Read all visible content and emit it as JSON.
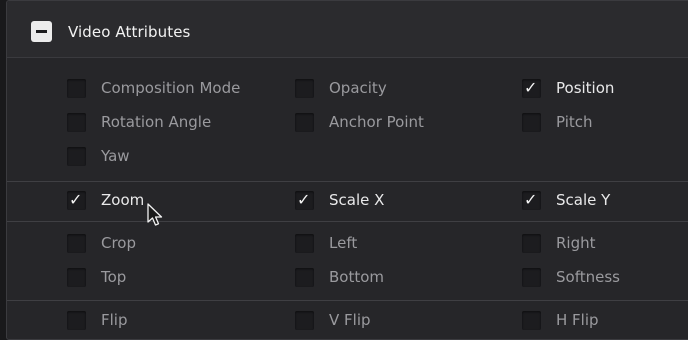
{
  "panel": {
    "title": "Video Attributes",
    "collapse_icon": "minus-icon",
    "check_glyph": "✓"
  },
  "colors": {
    "panel_bg": "#262629",
    "checkbox_bg": "#1c1c1f",
    "label_active": "#e9e9ea",
    "label_inactive": "#9a9a9e"
  },
  "attributes": {
    "composition_mode": {
      "label": "Composition Mode",
      "checked": false
    },
    "opacity": {
      "label": "Opacity",
      "checked": false
    },
    "position": {
      "label": "Position",
      "checked": true
    },
    "rotation_angle": {
      "label": "Rotation Angle",
      "checked": false
    },
    "anchor_point": {
      "label": "Anchor Point",
      "checked": false
    },
    "pitch": {
      "label": "Pitch",
      "checked": false
    },
    "yaw": {
      "label": "Yaw",
      "checked": false
    },
    "zoom": {
      "label": "Zoom",
      "checked": true
    },
    "scale_x": {
      "label": "Scale X",
      "checked": true
    },
    "scale_y": {
      "label": "Scale Y",
      "checked": true
    },
    "crop": {
      "label": "Crop",
      "checked": false
    },
    "left": {
      "label": "Left",
      "checked": false
    },
    "right": {
      "label": "Right",
      "checked": false
    },
    "top": {
      "label": "Top",
      "checked": false
    },
    "bottom": {
      "label": "Bottom",
      "checked": false
    },
    "softness": {
      "label": "Softness",
      "checked": false
    },
    "flip": {
      "label": "Flip",
      "checked": false
    },
    "v_flip": {
      "label": "V Flip",
      "checked": false
    },
    "h_flip": {
      "label": "H Flip",
      "checked": false
    }
  }
}
